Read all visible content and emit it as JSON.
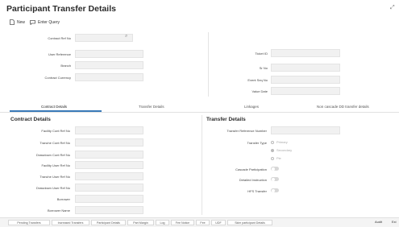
{
  "page_title": "Participant Transfer Details",
  "toolbar": {
    "new_label": "New",
    "enter_query_label": "Enter Query"
  },
  "header_left": [
    {
      "label": "Contract Ref No"
    },
    {
      "label": "User Reference"
    },
    {
      "label": "Branch"
    },
    {
      "label": "Contract Currency"
    }
  ],
  "header_right": [
    {
      "label": "Ticket ID"
    },
    {
      "label": "Sr No"
    },
    {
      "label": "Event Seq No"
    },
    {
      "label": "Value Date"
    }
  ],
  "tabs": [
    {
      "label": "Contract Details"
    },
    {
      "label": "Transfer Details"
    },
    {
      "label": "Linkages"
    },
    {
      "label": "Non cascade DD transfer details"
    }
  ],
  "contract_details": {
    "title": "Contract Details",
    "fields": [
      {
        "label": "Facility Cont Ref No"
      },
      {
        "label": "Tranche Cont Ref No"
      },
      {
        "label": "Drawdown Cont Ref No"
      },
      {
        "label": "Facility User Ref No"
      },
      {
        "label": "Tranche User Ref No"
      },
      {
        "label": "Drawdown User Ref No"
      },
      {
        "label": "Borrower"
      },
      {
        "label": "Borrower Name"
      }
    ]
  },
  "transfer_details": {
    "title": "Transfer Details",
    "ref_label": "Transfer Reference Number",
    "type_label": "Transfer Type",
    "type_options": [
      "Primary",
      "Secondary",
      "Pie"
    ],
    "selected_option": "Secondary",
    "cascade_label": "Cascade Participation",
    "detailed_label": "Detailed Instruction",
    "hfs_label": "HFS Transfer"
  },
  "bottom_bar": {
    "buttons": [
      "Pending Transfers",
      "Increased Transfers",
      "Participant Details",
      "Part Margin",
      "Log",
      "Fee Notice",
      "Fee",
      "UDF",
      "Skim participant Details"
    ],
    "audit_label": "Audit",
    "exit_label": "Exi"
  }
}
